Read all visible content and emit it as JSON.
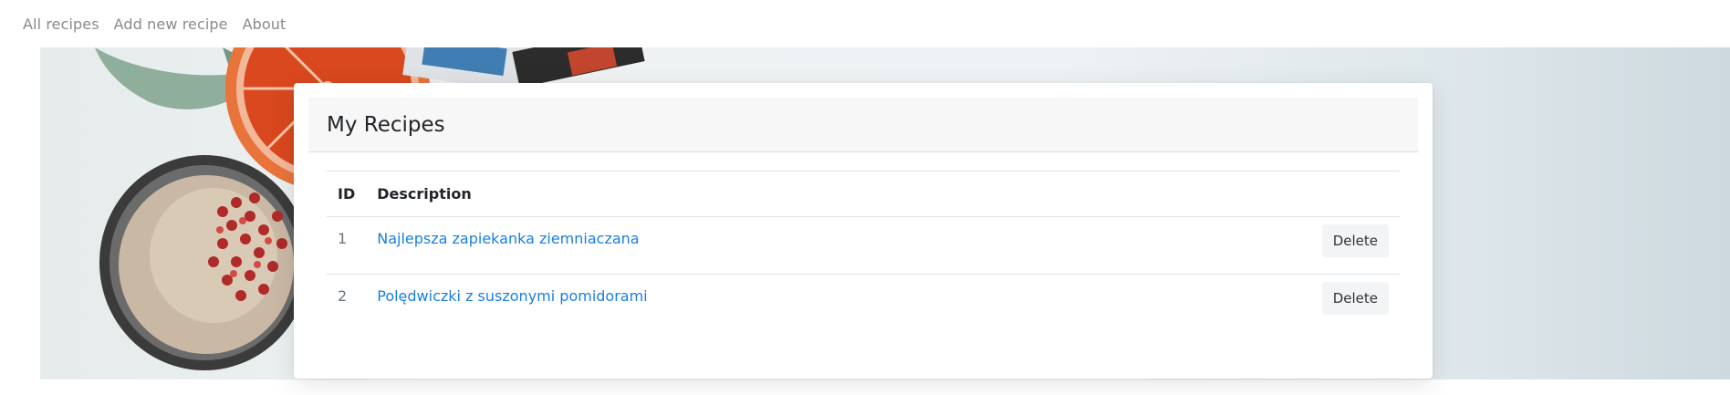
{
  "nav": {
    "items": [
      {
        "label": "All recipes"
      },
      {
        "label": "Add new recipe"
      },
      {
        "label": "About"
      }
    ]
  },
  "card": {
    "title": "My Recipes",
    "table": {
      "headers": {
        "id": "ID",
        "description": "Description"
      },
      "rows": [
        {
          "id": "1",
          "description": "Najlepsza zapiekanka ziemniaczana",
          "action": "Delete"
        },
        {
          "id": "2",
          "description": "Polędwiczki z suszonymi pomidorami",
          "action": "Delete"
        }
      ]
    }
  },
  "colors": {
    "link": "#1a7fe0",
    "nav_text": "#8a8a8a",
    "header_bg": "#f7f7f7"
  }
}
